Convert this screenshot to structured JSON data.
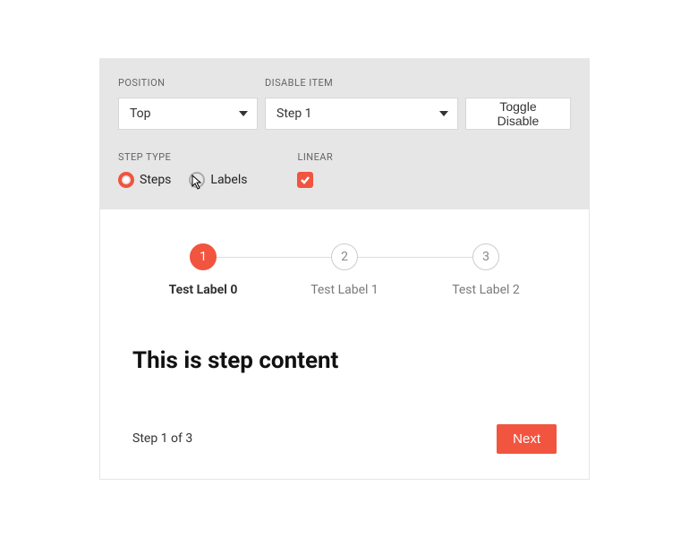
{
  "config": {
    "position": {
      "label": "POSITION",
      "value": "Top"
    },
    "disableItem": {
      "label": "DISABLE ITEM",
      "value": "Step 1"
    },
    "toggleButton": "Toggle Disable",
    "stepType": {
      "label": "STEP TYPE",
      "options": [
        {
          "label": "Steps",
          "selected": true
        },
        {
          "label": "Labels",
          "selected": false
        }
      ]
    },
    "linear": {
      "label": "LINEAR",
      "checked": true
    }
  },
  "stepper": {
    "steps": [
      {
        "num": "1",
        "label": "Test Label 0",
        "active": true
      },
      {
        "num": "2",
        "label": "Test Label 1",
        "active": false
      },
      {
        "num": "3",
        "label": "Test Label 2",
        "active": false
      }
    ]
  },
  "content": {
    "heading": "This is step content",
    "status": "Step 1 of 3",
    "nextButton": "Next"
  },
  "colors": {
    "accent": "#f1543f"
  }
}
